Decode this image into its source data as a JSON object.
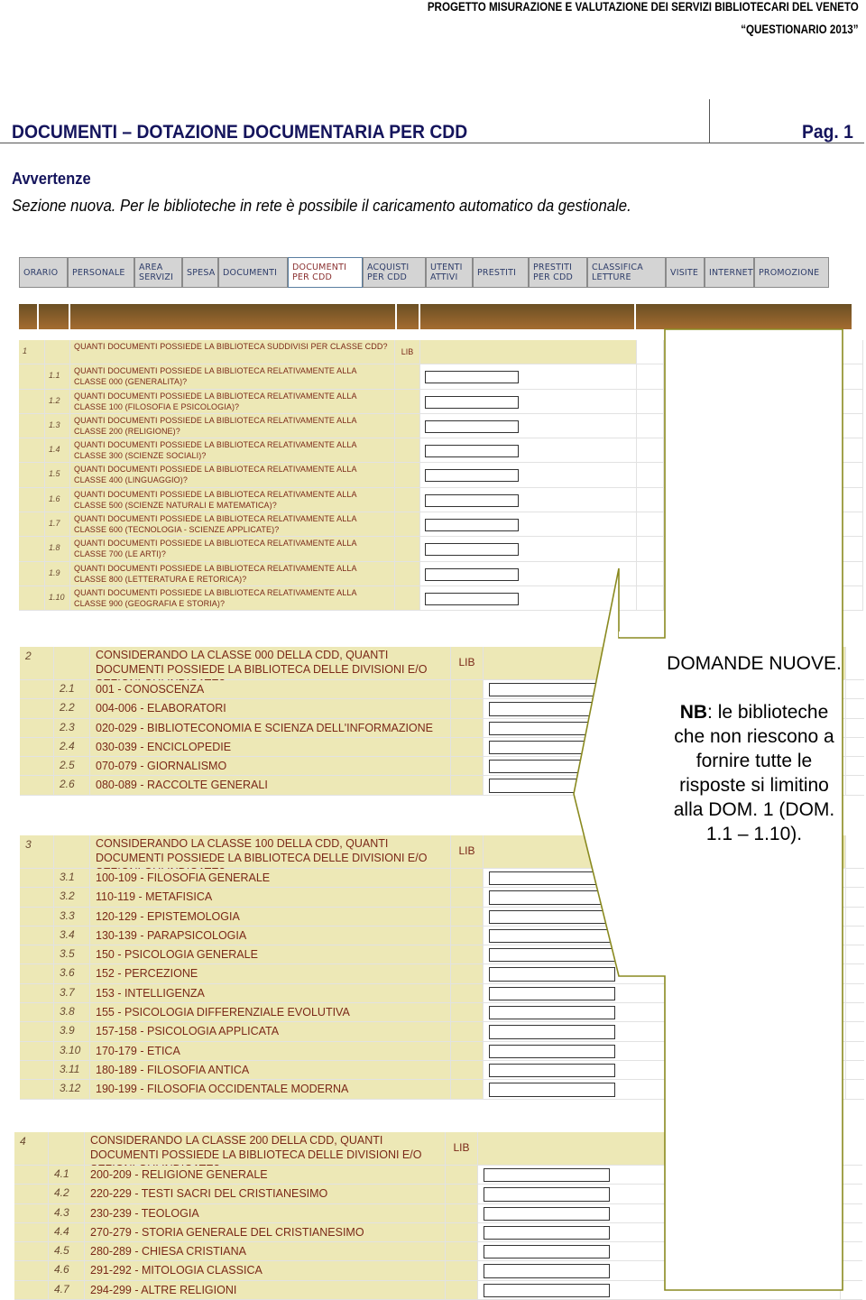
{
  "header": {
    "project": "PROGETTO MISURAZIONE E VALUTAZIONE DEI SERVIZI BIBLIOTECARI DEL VENETO",
    "questionnaire": "“QUESTIONARIO 2013”"
  },
  "title": "DOCUMENTI – DOTAZIONE DOCUMENTARIA PER CDD",
  "page": "Pag. 1",
  "warnings_heading": "Avvertenze",
  "warnings_text": "Sezione nuova. Per le biblioteche in rete è possibile il caricamento automatico da gestionale.",
  "tabs": [
    {
      "l1": "ORARIO",
      "l2": ""
    },
    {
      "l1": "PERSONALE",
      "l2": ""
    },
    {
      "l1": "AREA",
      "l2": "SERVIZI"
    },
    {
      "l1": "SPESA",
      "l2": ""
    },
    {
      "l1": "DOCUMENTI",
      "l2": ""
    },
    {
      "l1": "DOCUMENTI",
      "l2": "PER CDD",
      "active": true
    },
    {
      "l1": "ACQUISTI",
      "l2": "PER CDD"
    },
    {
      "l1": "UTENTI",
      "l2": "ATTIVI"
    },
    {
      "l1": "PRESTITI",
      "l2": ""
    },
    {
      "l1": "PRESTITI",
      "l2": "PER CDD"
    },
    {
      "l1": "CLASSIFICA",
      "l2": "LETTURE"
    },
    {
      "l1": "VISITE",
      "l2": ""
    },
    {
      "l1": "INTERNET",
      "l2": ""
    },
    {
      "l1": "PROMOZIONE",
      "l2": ""
    }
  ],
  "section1": {
    "number": "1",
    "question": "QUANTI DOCUMENTI POSSIEDE LA BIBLIOTECA SUDDIVISI PER CLASSE CDD?",
    "lib": "LIB",
    "items": [
      {
        "n": "1.1",
        "q": "QUANTI DOCUMENTI POSSIEDE LA BIBLIOTECA RELATIVAMENTE ALLA CLASSE 000 (GENERALITA)?"
      },
      {
        "n": "1.2",
        "q": "QUANTI DOCUMENTI POSSIEDE LA BIBLIOTECA RELATIVAMENTE ALLA CLASSE 100 (FILOSOFIA E PSICOLOGIA)?"
      },
      {
        "n": "1.3",
        "q": "QUANTI DOCUMENTI POSSIEDE LA BIBLIOTECA RELATIVAMENTE ALLA CLASSE 200 (RELIGIONE)?"
      },
      {
        "n": "1.4",
        "q": "QUANTI DOCUMENTI POSSIEDE LA BIBLIOTECA RELATIVAMENTE ALLA CLASSE 300 (SCIENZE SOCIALI)?"
      },
      {
        "n": "1.5",
        "q": "QUANTI DOCUMENTI POSSIEDE LA BIBLIOTECA RELATIVAMENTE ALLA CLASSE 400 (LINGUAGGIO)?"
      },
      {
        "n": "1.6",
        "q": "QUANTI DOCUMENTI POSSIEDE LA BIBLIOTECA RELATIVAMENTE ALLA CLASSE 500 (SCIENZE NATURALI E MATEMATICA)?"
      },
      {
        "n": "1.7",
        "q": "QUANTI DOCUMENTI POSSIEDE LA BIBLIOTECA RELATIVAMENTE ALLA CLASSE 600 (TECNOLOGIA - SCIENZE APPLICATE)?"
      },
      {
        "n": "1.8",
        "q": "QUANTI DOCUMENTI POSSIEDE LA BIBLIOTECA RELATIVAMENTE ALLA CLASSE 700 (LE ARTI)?"
      },
      {
        "n": "1.9",
        "q": "QUANTI DOCUMENTI POSSIEDE LA BIBLIOTECA RELATIVAMENTE ALLA CLASSE 800 (LETTERATURA E RETORICA)?"
      },
      {
        "n": "1.10",
        "q": "QUANTI DOCUMENTI POSSIEDE LA BIBLIOTECA RELATIVAMENTE ALLA CLASSE 900 (GEOGRAFIA E STORIA)?"
      }
    ]
  },
  "section2": {
    "number": "2",
    "question": "CONSIDERANDO LA CLASSE 000 DELLA CDD, QUANTI DOCUMENTI POSSIEDE LA BIBLIOTECA DELLE DIVISIONI E/O SEZIONI QUI INDICATE?",
    "lib": "LIB",
    "items": [
      {
        "n": "2.1",
        "q": "001 - CONOSCENZA"
      },
      {
        "n": "2.2",
        "q": "004-006 - ELABORATORI"
      },
      {
        "n": "2.3",
        "q": "020-029 - BIBLIOTECONOMIA E SCIENZA DELL'INFORMAZIONE"
      },
      {
        "n": "2.4",
        "q": "030-039 - ENCICLOPEDIE"
      },
      {
        "n": "2.5",
        "q": "070-079 - GIORNALISMO"
      },
      {
        "n": "2.6",
        "q": "080-089 - RACCOLTE GENERALI"
      }
    ]
  },
  "section3": {
    "number": "3",
    "question": "CONSIDERANDO LA CLASSE 100 DELLA CDD, QUANTI DOCUMENTI POSSIEDE LA BIBLIOTECA DELLE DIVISIONI E/O SEZIONI QUI INDICATE?",
    "lib": "LIB",
    "items": [
      {
        "n": "3.1",
        "q": "100-109 - FILOSOFIA GENERALE"
      },
      {
        "n": "3.2",
        "q": "110-119 - METAFISICA"
      },
      {
        "n": "3.3",
        "q": "120-129 - EPISTEMOLOGIA"
      },
      {
        "n": "3.4",
        "q": "130-139 - PARAPSICOLOGIA"
      },
      {
        "n": "3.5",
        "q": "150 - PSICOLOGIA GENERALE"
      },
      {
        "n": "3.6",
        "q": "152 - PERCEZIONE"
      },
      {
        "n": "3.7",
        "q": "153 - INTELLIGENZA"
      },
      {
        "n": "3.8",
        "q": "155 - PSICOLOGIA DIFFERENZIALE EVOLUTIVA"
      },
      {
        "n": "3.9",
        "q": "157-158 - PSICOLOGIA APPLICATA"
      },
      {
        "n": "3.10",
        "q": "170-179 - ETICA"
      },
      {
        "n": "3.11",
        "q": "180-189 - FILOSOFIA ANTICA"
      },
      {
        "n": "3.12",
        "q": "190-199 - FILOSOFIA OCCIDENTALE MODERNA"
      }
    ]
  },
  "section4": {
    "number": "4",
    "question": "CONSIDERANDO LA CLASSE 200 DELLA CDD, QUANTI DOCUMENTI POSSIEDE LA BIBLIOTECA DELLE DIVISIONI E/O SEZIONI QUI INDICATE?",
    "lib": "LIB",
    "items": [
      {
        "n": "4.1",
        "q": "200-209 - RELIGIONE GENERALE"
      },
      {
        "n": "4.2",
        "q": "220-229 - TESTI SACRI DEL CRISTIANESIMO"
      },
      {
        "n": "4.3",
        "q": "230-239 - TEOLOGIA"
      },
      {
        "n": "4.4",
        "q": "270-279 - STORIA GENERALE DEL CRISTIANESIMO"
      },
      {
        "n": "4.5",
        "q": "280-289 - CHIESA CRISTIANA"
      },
      {
        "n": "4.6",
        "q": "291-292 - MITOLOGIA CLASSICA"
      },
      {
        "n": "4.7",
        "q": "294-299 - ALTRE RELIGIONI"
      }
    ]
  },
  "callout": {
    "line1": "DOMANDE NUOVE.",
    "nb_label": "NB",
    "nb_text": ": le biblioteche che non riescono a fornire tutte le risposte si limitino alla DOM. 1 (DOM. 1.1 – 1.10)."
  },
  "colors": {
    "title": "#14145c",
    "row_bg": "#ede8b6",
    "question_text": "#7a2818",
    "header_bar": "#8a5a28",
    "callout_border": "#8a8a20"
  }
}
